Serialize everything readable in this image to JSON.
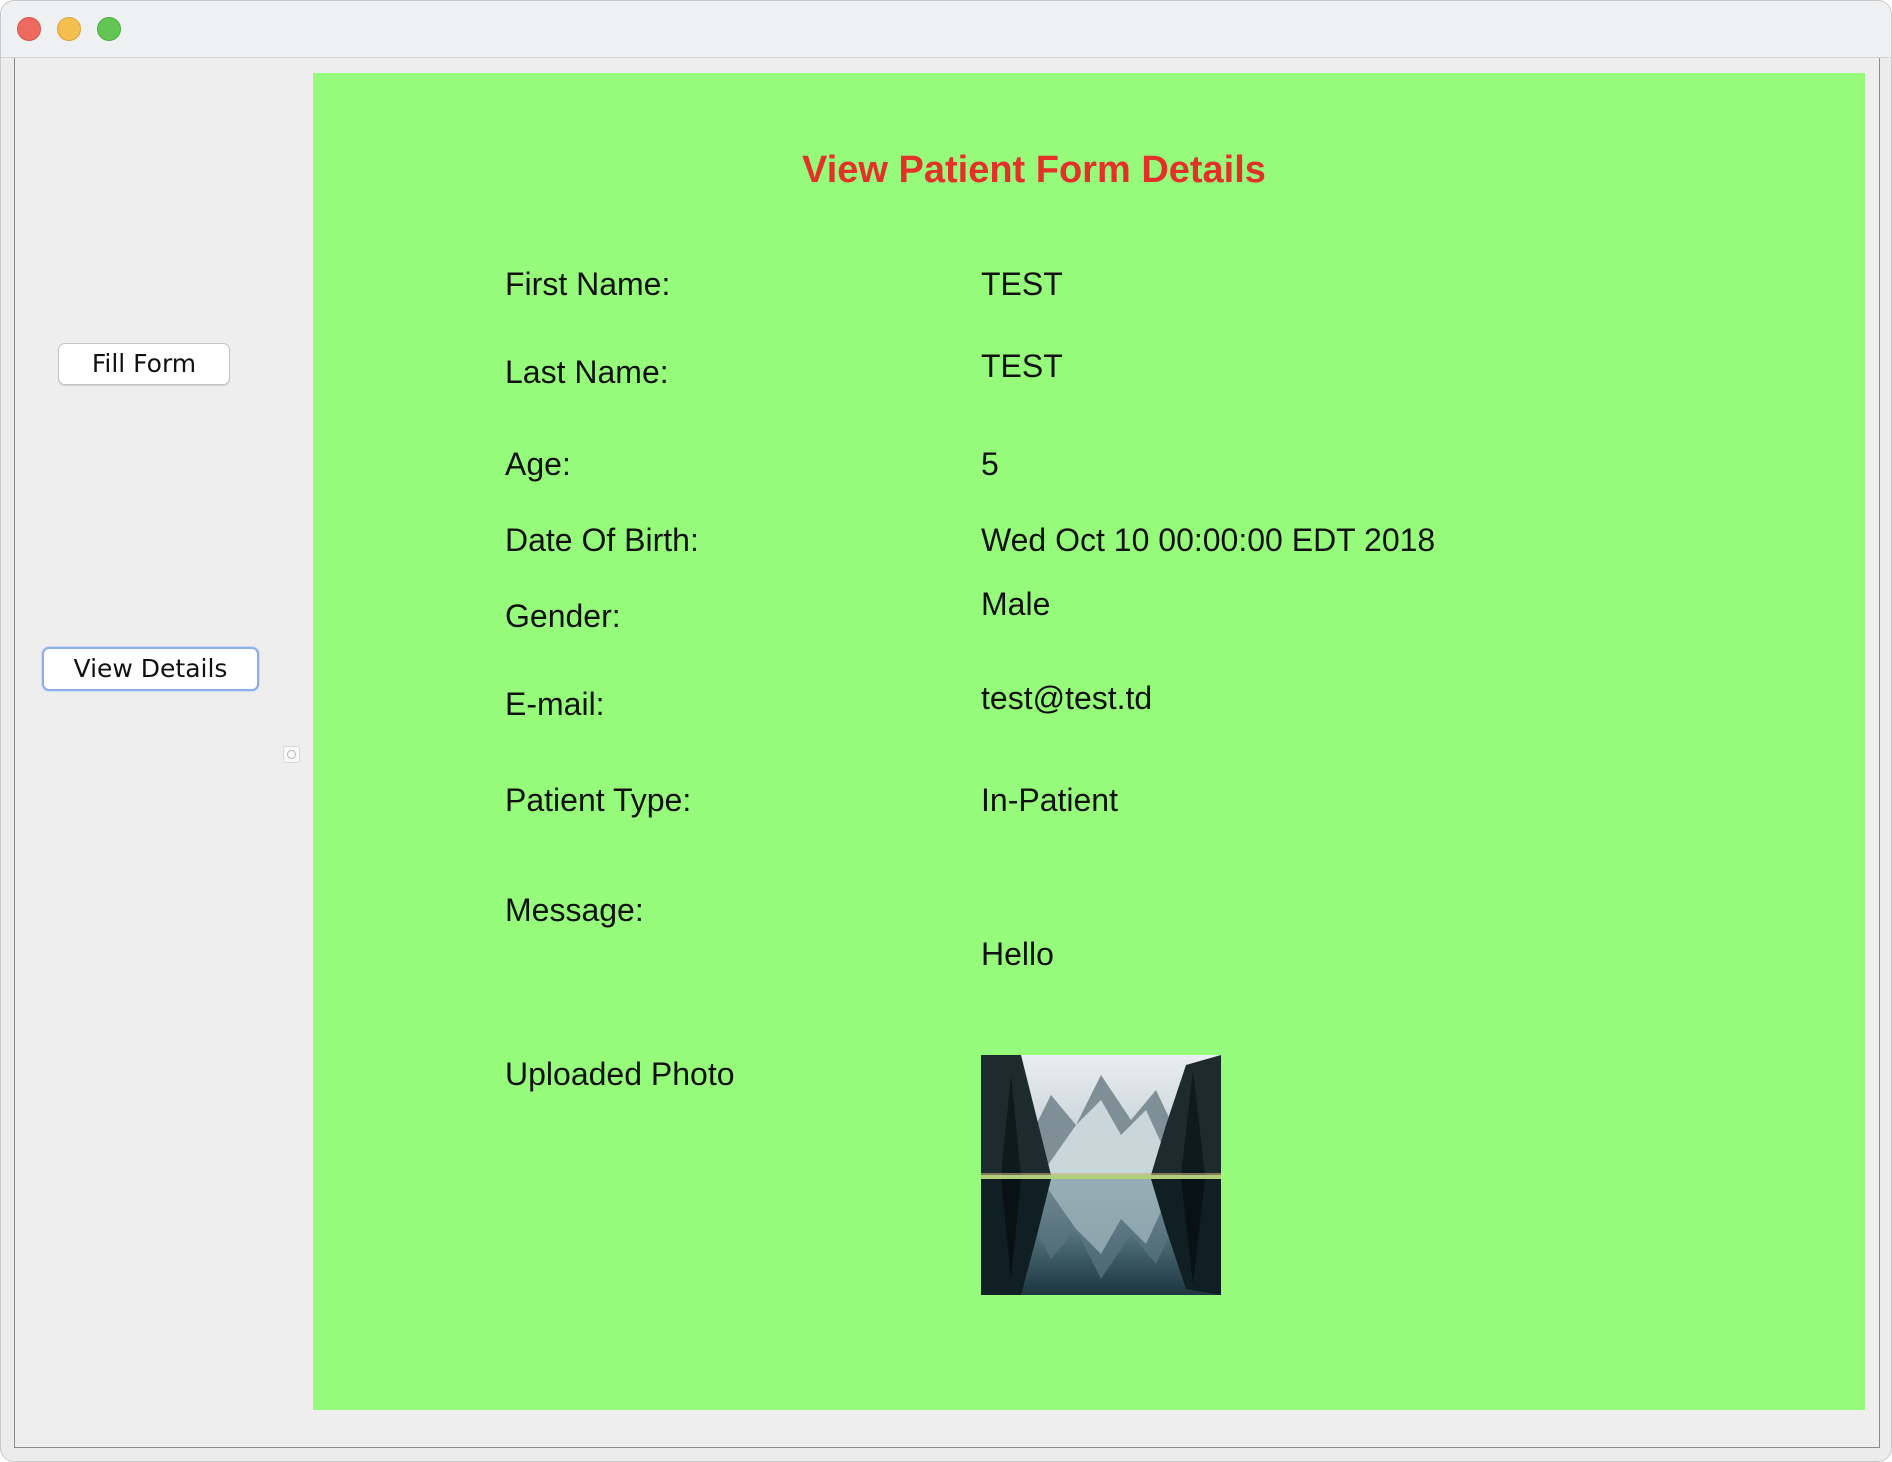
{
  "window": {
    "controls": [
      "close-icon",
      "minimize-icon",
      "zoom-icon"
    ]
  },
  "sidebar": {
    "fill_form_label": "Fill Form",
    "view_details_label": "View Details"
  },
  "panel": {
    "title": "View Patient Form Details",
    "fields": {
      "first_name": {
        "label": "First Name:",
        "value": "TEST"
      },
      "last_name": {
        "label": "Last Name:",
        "value": "TEST"
      },
      "age": {
        "label": "Age:",
        "value": "5"
      },
      "dob": {
        "label": "Date Of Birth:",
        "value": "Wed Oct 10 00:00:00 EDT 2018"
      },
      "gender": {
        "label": "Gender:",
        "value": "Male"
      },
      "email": {
        "label": "E-mail:",
        "value": "test@test.td"
      },
      "patient_type": {
        "label": "Patient Type:",
        "value": "In-Patient"
      },
      "message": {
        "label": "Message:",
        "value": "Hello"
      },
      "photo": {
        "label": "Uploaded Photo"
      }
    }
  },
  "colors": {
    "panel_bg": "#96fb7a",
    "title_color": "#e3312a"
  }
}
